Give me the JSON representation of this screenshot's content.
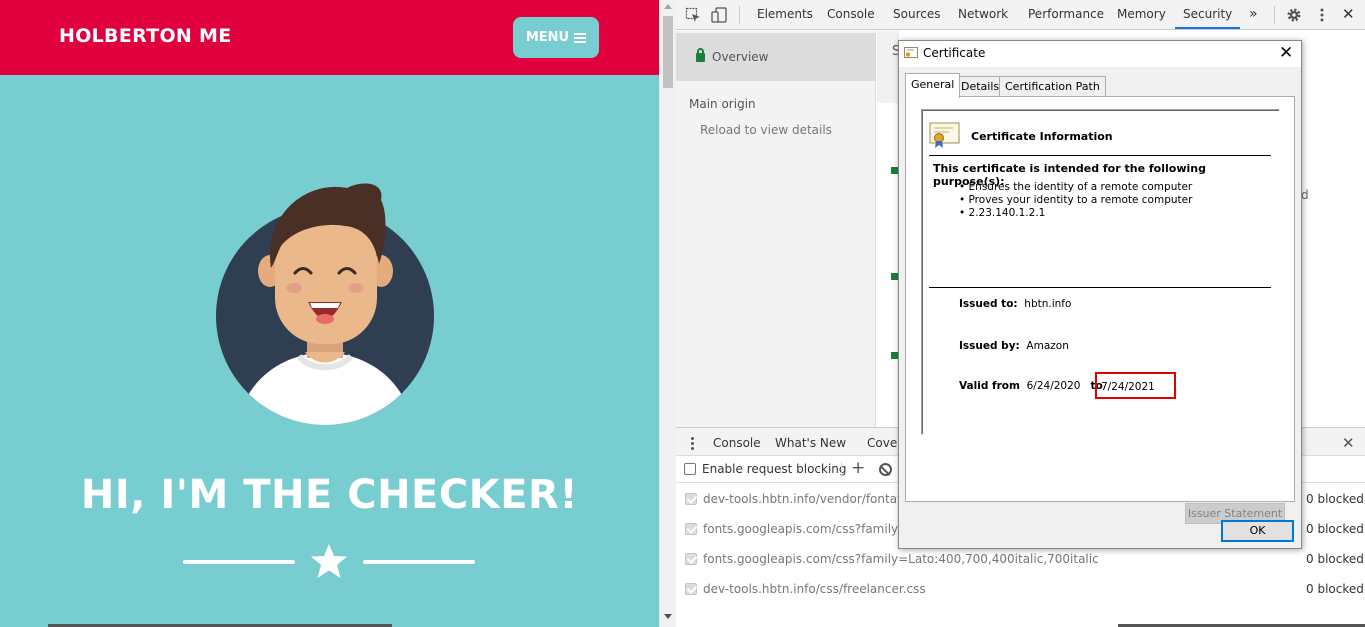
{
  "site": {
    "brand": "HOLBERTON ME",
    "menu_label": "MENU",
    "hero_title": "HI, I'M THE CHECKER!",
    "colors": {
      "header": "#e1003e",
      "accent": "#78cdd1"
    }
  },
  "devtools": {
    "tabs": [
      {
        "label": "Elements"
      },
      {
        "label": "Console"
      },
      {
        "label": "Sources"
      },
      {
        "label": "Network"
      },
      {
        "label": "Performance"
      },
      {
        "label": "Memory"
      },
      {
        "label": "Security",
        "active": true
      }
    ],
    "more_tabs": "»",
    "security": {
      "overview": "Overview",
      "main_origin": "Main origin",
      "reload": "Reload to view details",
      "s_letter": "S",
      "d_fragment": "d"
    },
    "drawer": {
      "tabs": [
        "Console",
        "What's New",
        "Cover"
      ],
      "enable_blocking": "Enable request blocking",
      "rows": [
        {
          "url": "dev-tools.hbtn.info/vendor/fontawes",
          "count": "0 blocked"
        },
        {
          "url": "fonts.googleapis.com/css?family=Mo",
          "count": "0 blocked"
        },
        {
          "url": "fonts.googleapis.com/css?family=Lato:400,700,400italic,700italic",
          "count": "0 blocked"
        },
        {
          "url": "dev-tools.hbtn.info/css/freelancer.css",
          "count": "0 blocked"
        }
      ]
    }
  },
  "certificate": {
    "title": "Certificate",
    "tabs": [
      "General",
      "Details",
      "Certification Path"
    ],
    "info_heading": "Certificate Information",
    "purpose_heading": "This certificate is intended for the following purpose(s):",
    "purposes": [
      "• Ensures the identity of a remote computer",
      "• Proves your identity to a remote computer",
      "• 2.23.140.1.2.1"
    ],
    "issued_to_label": "Issued to:",
    "issued_to": "hbtn.info",
    "issued_by_label": "Issued by:",
    "issued_by": "Amazon",
    "valid_from_label": "Valid from",
    "valid_from": "6/24/2020",
    "to_label": "to",
    "valid_to": "7/24/2021",
    "issuer_statement": "Issuer Statement",
    "ok": "OK"
  }
}
